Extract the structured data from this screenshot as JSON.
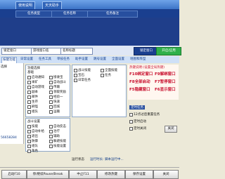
{
  "window": {
    "tabs": [
      "使用说明",
      "天天助手"
    ],
    "columns": [
      "任务类型",
      "任务名称",
      "任务备注"
    ]
  },
  "toolbar": {
    "dropdown1": "锁定窗口",
    "dropdown2": "游戏窗口名",
    "dropdown3": "名称标题",
    "btn_lock": "锁定窗口",
    "btn_apply": "开启/应用"
  },
  "function_tabs": [
    "按键功能",
    "日常设置",
    "任务工具",
    "单技任务",
    "助手设置",
    "跳号设置",
    "全面设置",
    "地图和阵型"
  ],
  "left_panel": {
    "header": "选择",
    "value": "56658284"
  },
  "function_settings": {
    "title": "功能选择",
    "group1": "基础",
    "checks": [
      "启动通知",
      "接收宝",
      "采矿",
      "自动战斗",
      "自动游戏",
      "传输",
      "副本",
      "领取奖励",
      "邮件",
      "经验一",
      "生存",
      "快速",
      "刷怪",
      "回城",
      "组队",
      "运输",
      "战斗技能",
      "全面技能",
      "宝石",
      "任务",
      "日常任务"
    ],
    "group2": "战斗设置",
    "checks2": [
      "技能",
      "自动反击",
      "自动补给",
      "治疗",
      "退出",
      "辅助",
      "防御",
      "躲避技能",
      "组队",
      "技能设置",
      "角色"
    ]
  },
  "hotkeys": {
    "title": "热键说明:(设置全局热键)",
    "lines": [
      [
        "F10",
        "绑定窗口",
        "F9",
        "解绑窗口"
      ],
      [
        "F8",
        "全部启动",
        "F7",
        "暂停窗口"
      ],
      [
        "F5",
        "隐藏窗口",
        "F6",
        "显示窗口"
      ]
    ]
  },
  "timing": {
    "title": "定时任务",
    "opt1": "12点过后重置任务",
    "opt2": "定时启动",
    "opt3": "定时关闭",
    "btn": "关闭",
    "run_time": "运行时长: 脚本运行中...",
    "run_label": "运行状态"
  },
  "bottom": {
    "buttons": [
      "启动F10",
      "停/继续Pause/Break",
      "中止F11",
      "修改热键",
      "保存设置",
      "关闭"
    ]
  },
  "colors": {
    "accent": "#1a3f8f",
    "hotkey": "#c8102e"
  }
}
